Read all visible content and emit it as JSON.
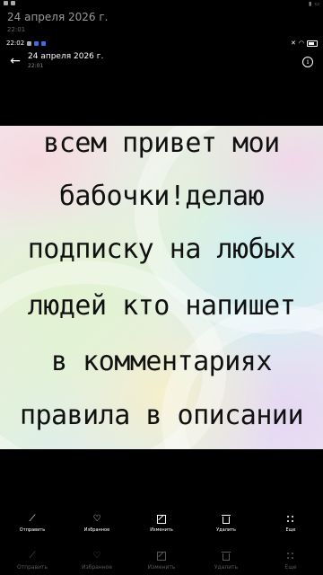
{
  "background_screen": {
    "title": "24 апреля 2026 г.",
    "time": "22:01",
    "toolbar": [
      {
        "label": "Отправить",
        "icon": "share-icon"
      },
      {
        "label": "Избранное",
        "icon": "heart-icon"
      },
      {
        "label": "Изменить",
        "icon": "edit-icon"
      },
      {
        "label": "Удалить",
        "icon": "trash-icon"
      },
      {
        "label": "Еще",
        "icon": "more-icon"
      }
    ]
  },
  "status_bar": {
    "time": "22:02"
  },
  "header": {
    "title": "24 апреля 2026 г.",
    "time": "22:01"
  },
  "photo": {
    "lines": [
      "всем привет мои",
      "бабочки!делаю",
      "подписку на любых",
      "людей кто напишет",
      "в комментариях",
      "правила в описании"
    ]
  },
  "toolbar": [
    {
      "label": "Отправить",
      "icon": "share-icon"
    },
    {
      "label": "Избранное",
      "icon": "heart-icon"
    },
    {
      "label": "Изменить",
      "icon": "edit-icon"
    },
    {
      "label": "Удалить",
      "icon": "trash-icon"
    },
    {
      "label": "Еще",
      "icon": "more-icon"
    }
  ],
  "colors": {
    "background": "#000000",
    "text": "#ffffff",
    "photo_text": "#111111",
    "status_accent": "#3b6fe0"
  }
}
